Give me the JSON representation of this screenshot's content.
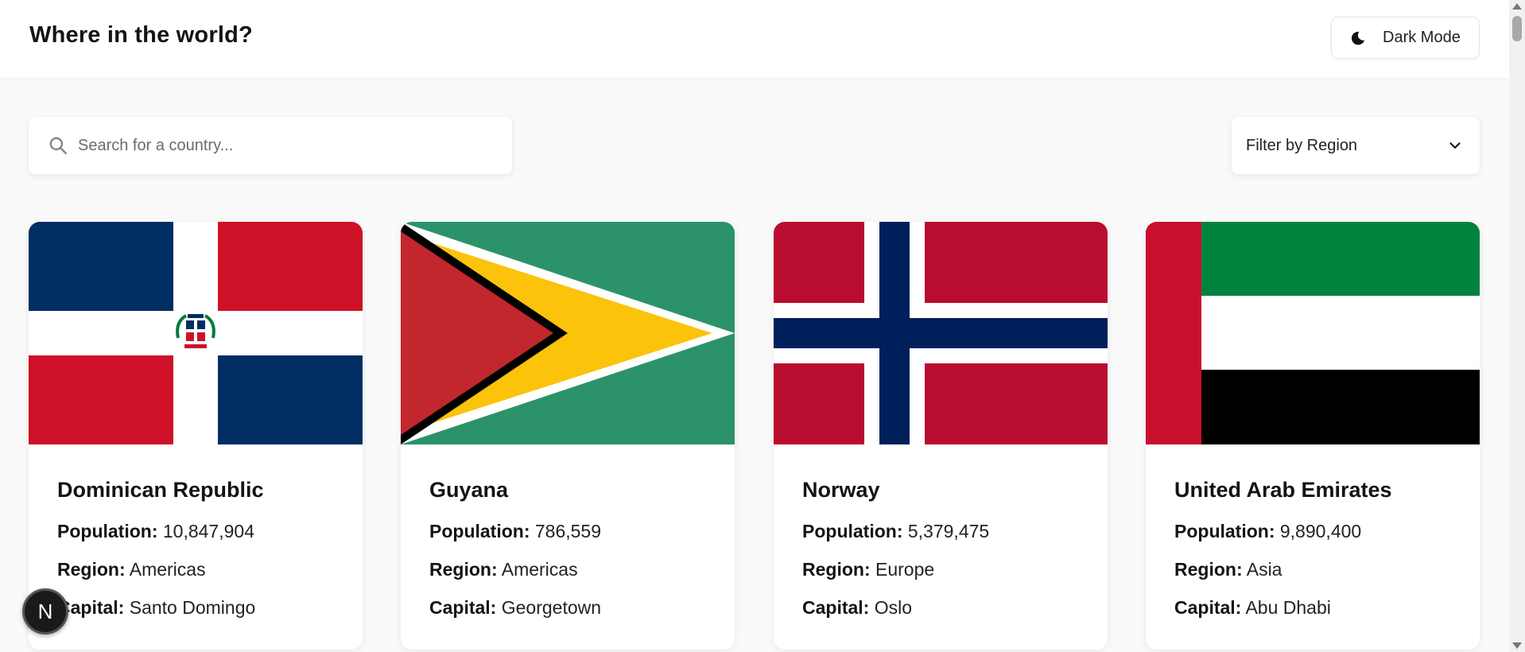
{
  "header": {
    "title": "Where in the world?",
    "theme_toggle_label": "Dark Mode"
  },
  "search": {
    "placeholder": "Search for a country...",
    "value": ""
  },
  "filter": {
    "label": "Filter by Region"
  },
  "labels": {
    "population": "Population:",
    "region": "Region:",
    "capital": "Capital:"
  },
  "countries": [
    {
      "name": "Dominican Republic",
      "population": "10,847,904",
      "region": "Americas",
      "capital": "Santo Domingo",
      "flag_icon": "dominican-republic-flag"
    },
    {
      "name": "Guyana",
      "population": "786,559",
      "region": "Americas",
      "capital": "Georgetown",
      "flag_icon": "guyana-flag"
    },
    {
      "name": "Norway",
      "population": "5,379,475",
      "region": "Europe",
      "capital": "Oslo",
      "flag_icon": "norway-flag"
    },
    {
      "name": "United Arab Emirates",
      "population": "9,890,400",
      "region": "Asia",
      "capital": "Abu Dhabi",
      "flag_icon": "uae-flag"
    }
  ],
  "badge": {
    "letter": "N"
  },
  "colors": {
    "background": "#fafafa",
    "surface": "#ffffff",
    "text": "#111517"
  }
}
